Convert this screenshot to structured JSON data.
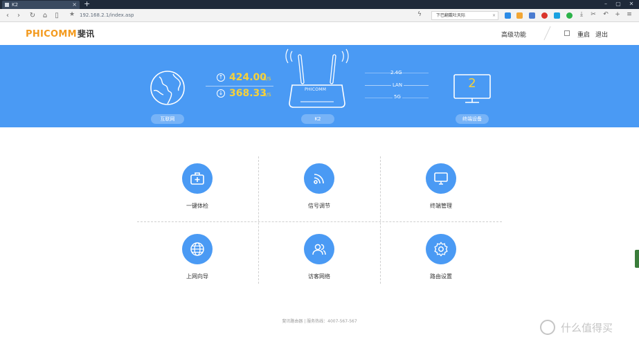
{
  "browser": {
    "tab_title": "K2",
    "tab_close": "×",
    "new_tab": "+",
    "window_buttons": [
      "–",
      "▢",
      "✕"
    ],
    "url": "192.168.2.1/index.asp",
    "search_placeholder": "下巴翻戴吐天际",
    "search_clear": "×"
  },
  "header": {
    "brand": "PHICOMM",
    "brand_cn": "斐讯",
    "advanced": "高级功能",
    "reboot": "重启",
    "logout": "退出"
  },
  "banner": {
    "internet_label": "互联网",
    "upload_speed": "424.00",
    "download_speed": "368.33",
    "speed_unit": "B/S",
    "router_brand": "PHICOMM",
    "router_label": "K2",
    "band_24": "2.4G",
    "band_lan": "LAN",
    "band_5g": "5G",
    "device_count": "2",
    "devices_label": "终端设备"
  },
  "tiles": [
    {
      "label": "一键体检",
      "icon": "first-aid-kit-icon"
    },
    {
      "label": "信号调节",
      "icon": "wifi-signal-icon"
    },
    {
      "label": "终端管理",
      "icon": "monitor-icon"
    },
    {
      "label": "上网向导",
      "icon": "globe-icon"
    },
    {
      "label": "访客网络",
      "icon": "guest-users-icon"
    },
    {
      "label": "路由设置",
      "icon": "gear-icon"
    }
  ],
  "footer": "斐讯路由器 | 服务热线：4007-567-567",
  "watermark": "什么值得买",
  "colors": {
    "accent_blue": "#4a9af4",
    "brand_orange": "#f39a1e",
    "speed_yellow": "#f6d13a"
  }
}
